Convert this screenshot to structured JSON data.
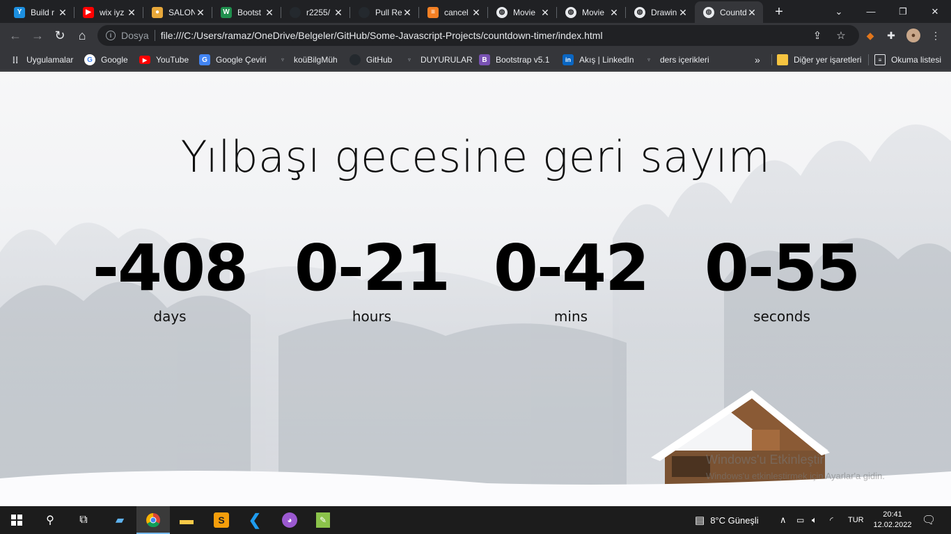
{
  "tabs": [
    {
      "title": "Build r",
      "icon": "yammer-icon",
      "color": "#1c8fe0"
    },
    {
      "title": "wix iyz",
      "icon": "youtube-icon",
      "color": "#ff0000"
    },
    {
      "title": "SALON",
      "icon": "burger-icon",
      "color": "#e8a83a"
    },
    {
      "title": "Bootst",
      "icon": "w-icon",
      "color": "#1f8f4d"
    },
    {
      "title": "r2255/",
      "icon": "github-icon",
      "color": "#24292e"
    },
    {
      "title": "Pull Re",
      "icon": "github-icon",
      "color": "#24292e"
    },
    {
      "title": "cancel",
      "icon": "stackoverflow-icon",
      "color": "#f48024"
    },
    {
      "title": "Movie",
      "icon": "globe-icon",
      "color": "#e8eaed"
    },
    {
      "title": "Movie",
      "icon": "globe-icon",
      "color": "#e8eaed"
    },
    {
      "title": "Drawin",
      "icon": "globe-icon",
      "color": "#e8eaed"
    },
    {
      "title": "Countd",
      "icon": "globe-icon",
      "color": "#e8eaed",
      "active": true
    }
  ],
  "toolbar": {
    "scheme": "Dosya",
    "url": "file:///C:/Users/ramaz/OneDrive/Belgeler/GitHub/Some-Javascript-Projects/countdown-timer/index.html"
  },
  "bookmarks": [
    {
      "label": "Uygulamalar",
      "icon": "apps-grid-icon"
    },
    {
      "label": "Google",
      "icon": "google-icon"
    },
    {
      "label": "YouTube",
      "icon": "youtube-icon"
    },
    {
      "label": "Google Çeviri",
      "icon": "translate-icon"
    },
    {
      "label": "koüBilgMüh",
      "icon": "kou-icon"
    },
    {
      "label": "GitHub",
      "icon": "github-icon"
    },
    {
      "label": "DUYURULAR",
      "icon": "kou-icon"
    },
    {
      "label": "Bootstrap v5.1",
      "icon": "bootstrap-icon"
    },
    {
      "label": "Akış | LinkedIn",
      "icon": "linkedin-icon"
    },
    {
      "label": "ders içerikleri",
      "icon": "kou-icon"
    }
  ],
  "bookmarks_right": {
    "more": "»",
    "other": "Diğer yer işaretleri",
    "reading": "Okuma listesi"
  },
  "page": {
    "title": "Yılbaşı gecesine geri sayım",
    "counters": [
      {
        "value": "-408",
        "label": "days"
      },
      {
        "value": "0-21",
        "label": "hours"
      },
      {
        "value": "0-42",
        "label": "mins"
      },
      {
        "value": "0-55",
        "label": "seconds"
      }
    ],
    "watermark_title": "Windows'u Etkinleştir",
    "watermark_sub": "Windows'u etkinleştirmek için Ayarlar'a gidin."
  },
  "taskbar": {
    "weather": "8°C  Güneşli",
    "lang": "TUR",
    "time": "20:41",
    "date": "12.02.2022"
  }
}
